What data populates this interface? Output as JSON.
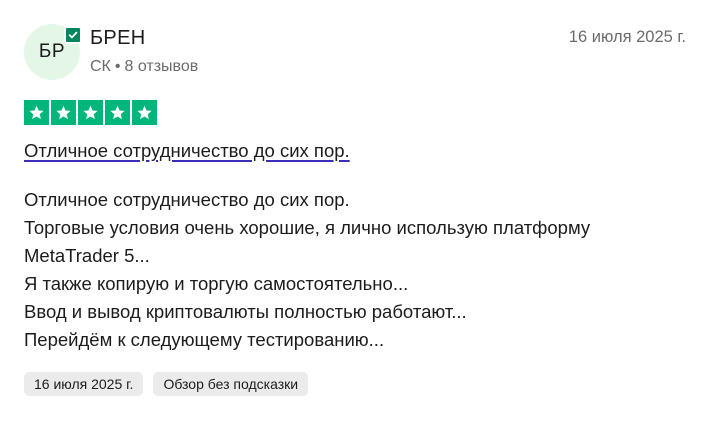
{
  "reviewer": {
    "initials": "БР",
    "name": "БРЕН",
    "country": "СК",
    "separator": "•",
    "reviews_count": "8 отзывов",
    "verified_icon": "check-badge-icon"
  },
  "review": {
    "date": "16 июля 2025 г.",
    "rating": 5,
    "rating_max": 5,
    "star_color": "#00b67a",
    "title": "Отличное сотрудничество до сих пор.",
    "body_lines": [
      "Отличное сотрудничество до сих пор.",
      "Торговые условия очень хорошие, я лично использую платформу",
      "MetaTrader 5...",
      "Я также копирую и торгую самостоятельно...",
      "Ввод и вывод криптовалюты полностью работают...",
      "Перейдём к следующему тестированию..."
    ]
  },
  "tags": [
    "16 июля 2025 г.",
    "Обзор без подсказки"
  ],
  "colors": {
    "avatar_bg": "#e4f7e6",
    "verified_badge": "#04865e",
    "title_underline": "#3b2fb8",
    "tag_bg": "#ebebeb",
    "muted_text": "#6b6b6b"
  }
}
